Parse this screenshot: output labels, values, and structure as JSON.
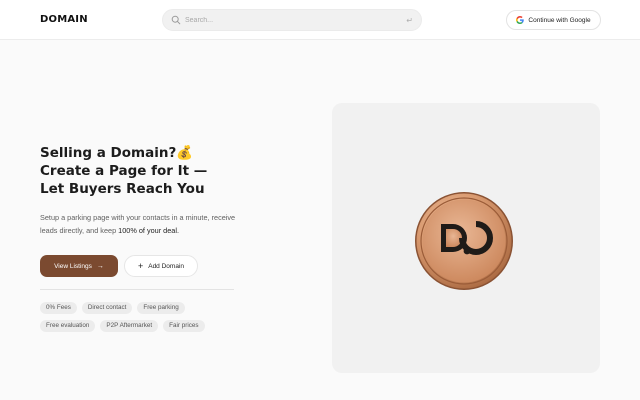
{
  "header": {
    "logo_text": "DOMAIN",
    "search": {
      "placeholder": "Search..."
    },
    "google_button_label": "Continue with Google"
  },
  "hero": {
    "headline_line1": "Selling a Domain?💰",
    "headline_line2": "Create a Page for It —",
    "headline_line3": "Let Buyers Reach You",
    "sub_part1": "Setup a parking page with your contacts in a minute, receive leads directly, and keep ",
    "sub_strong": "100% of your deal.",
    "primary_button_label": "View Listings",
    "secondary_button_label": "Add Domain"
  },
  "tags": {
    "row1": [
      "0% Fees",
      "Direct contact",
      "Free parking"
    ],
    "row2": [
      "Free evaluation",
      "P2P Aftermarket",
      "Fair prices"
    ]
  },
  "icons": {
    "search": "search-icon",
    "enter": "enter-key-icon",
    "google": "google-icon",
    "arrow": "arrow-right-icon",
    "plus": "plus-icon",
    "coin": "domain-coin-logo"
  },
  "colors": {
    "accent": "#7b4a30",
    "coin_light": "#e3ad88",
    "coin_dark": "#a8673f",
    "background": "#fafafa",
    "panel": "#f1f1f1"
  }
}
